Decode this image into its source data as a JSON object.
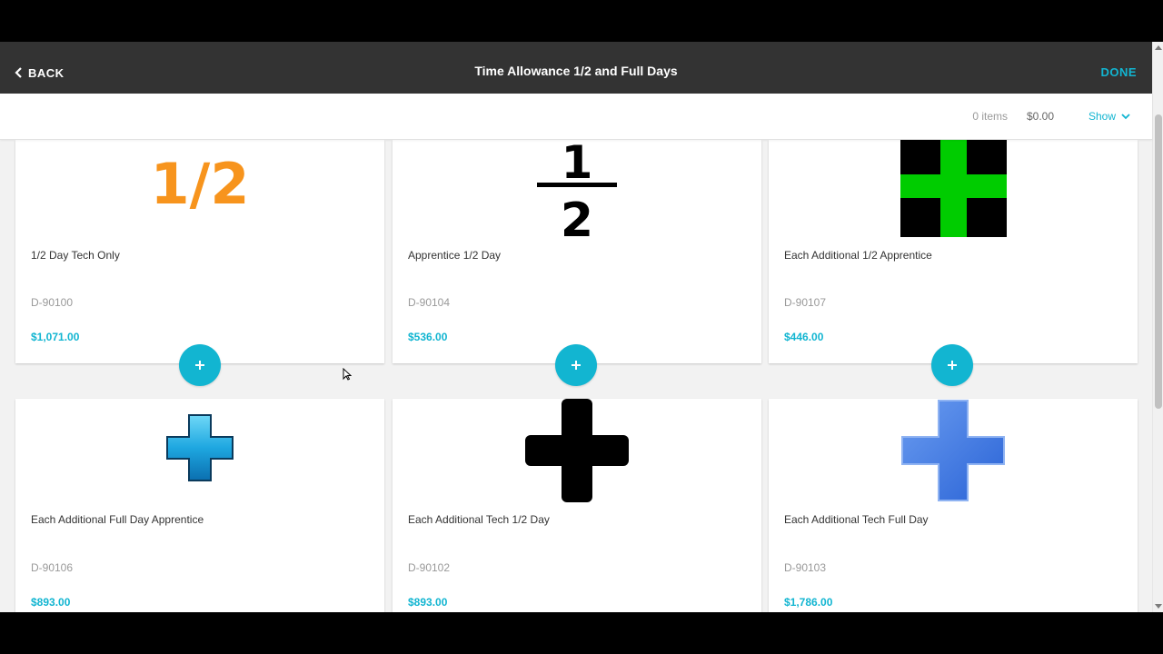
{
  "header": {
    "back_label": "BACK",
    "title": "Time Allowance 1/2 and Full Days",
    "done_label": "DONE"
  },
  "subbar": {
    "items_count": "0 items",
    "total": "$0.00",
    "show_label": "Show"
  },
  "products": [
    {
      "name": "1/2 Day Tech Only",
      "sku": "D-90100",
      "price": "$1,071.00",
      "image": "orange-half-text",
      "image_text": "1/2"
    },
    {
      "name": "Apprentice 1/2 Day",
      "sku": "D-90104",
      "price": "$536.00",
      "image": "black-fraction-half",
      "image_num": "1",
      "image_den": "2"
    },
    {
      "name": "Each Additional 1/2 Apprentice",
      "sku": "D-90107",
      "price": "$446.00",
      "image": "green-plus-on-black"
    },
    {
      "name": "Each Additional Full Day Apprentice",
      "sku": "D-90106",
      "price": "$893.00",
      "image": "cyan-glossy-plus"
    },
    {
      "name": "Each Additional Tech 1/2 Day",
      "sku": "D-90102",
      "price": "$893.00",
      "image": "black-plus"
    },
    {
      "name": "Each Additional Tech Full Day",
      "sku": "D-90103",
      "price": "$1,786.00",
      "image": "blue-plus"
    }
  ],
  "colors": {
    "accent": "#12b5d1",
    "header_bg": "#333333",
    "orange": "#f7941d",
    "green": "#00cc00"
  }
}
